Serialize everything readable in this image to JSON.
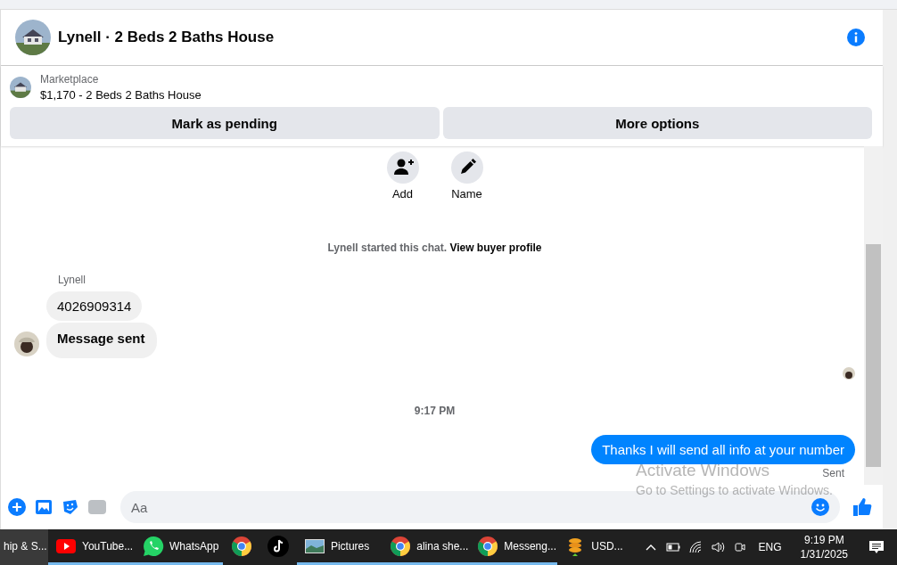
{
  "header": {
    "title": "Lynell · 2 Beds 2 Baths House"
  },
  "listing": {
    "source": "Marketplace",
    "price_title": "$1,170 - 2 Beds 2 Baths House",
    "buttons": [
      "Mark as pending",
      "More options"
    ]
  },
  "actions": [
    {
      "kind": "add",
      "label": "Add"
    },
    {
      "kind": "name",
      "label": "Name"
    }
  ],
  "chat_start": {
    "text": "Lynell started this chat.",
    "link": "View buyer profile"
  },
  "incoming": {
    "sender": "Lynell",
    "messages": [
      {
        "text": "4026909314",
        "bold": false
      },
      {
        "text": "Message sent",
        "bold": true
      }
    ]
  },
  "timestamp": "9:17 PM",
  "outgoing": {
    "text": "Thanks I will send all info at your number",
    "status": "Sent"
  },
  "composer": {
    "placeholder": "Aa"
  },
  "os_notice": {
    "title": "Activate Windows",
    "subtitle": "Go to Settings to activate Windows."
  },
  "taskbar": {
    "items": [
      {
        "kind": "text",
        "label": "hip & S...",
        "selected": true,
        "running": false
      },
      {
        "kind": "youtube",
        "label": "YouTube...",
        "selected": false,
        "running": true
      },
      {
        "kind": "whatsapp",
        "label": "WhatsApp",
        "selected": false,
        "running": true
      },
      {
        "kind": "chrome",
        "selected": false,
        "running": false
      },
      {
        "kind": "tiktok",
        "selected": false,
        "running": false
      },
      {
        "kind": "pictures",
        "label": "Pictures",
        "selected": false,
        "running": true
      },
      {
        "kind": "chrome",
        "label": "alina she...",
        "selected": false,
        "running": true
      },
      {
        "kind": "chrome",
        "label": "Messeng...",
        "selected": false,
        "running": true
      },
      {
        "kind": "coins",
        "label": "USD...",
        "selected": false,
        "running": false
      }
    ],
    "language": "ENG",
    "time": "9:19 PM",
    "date": "1/31/2025"
  }
}
